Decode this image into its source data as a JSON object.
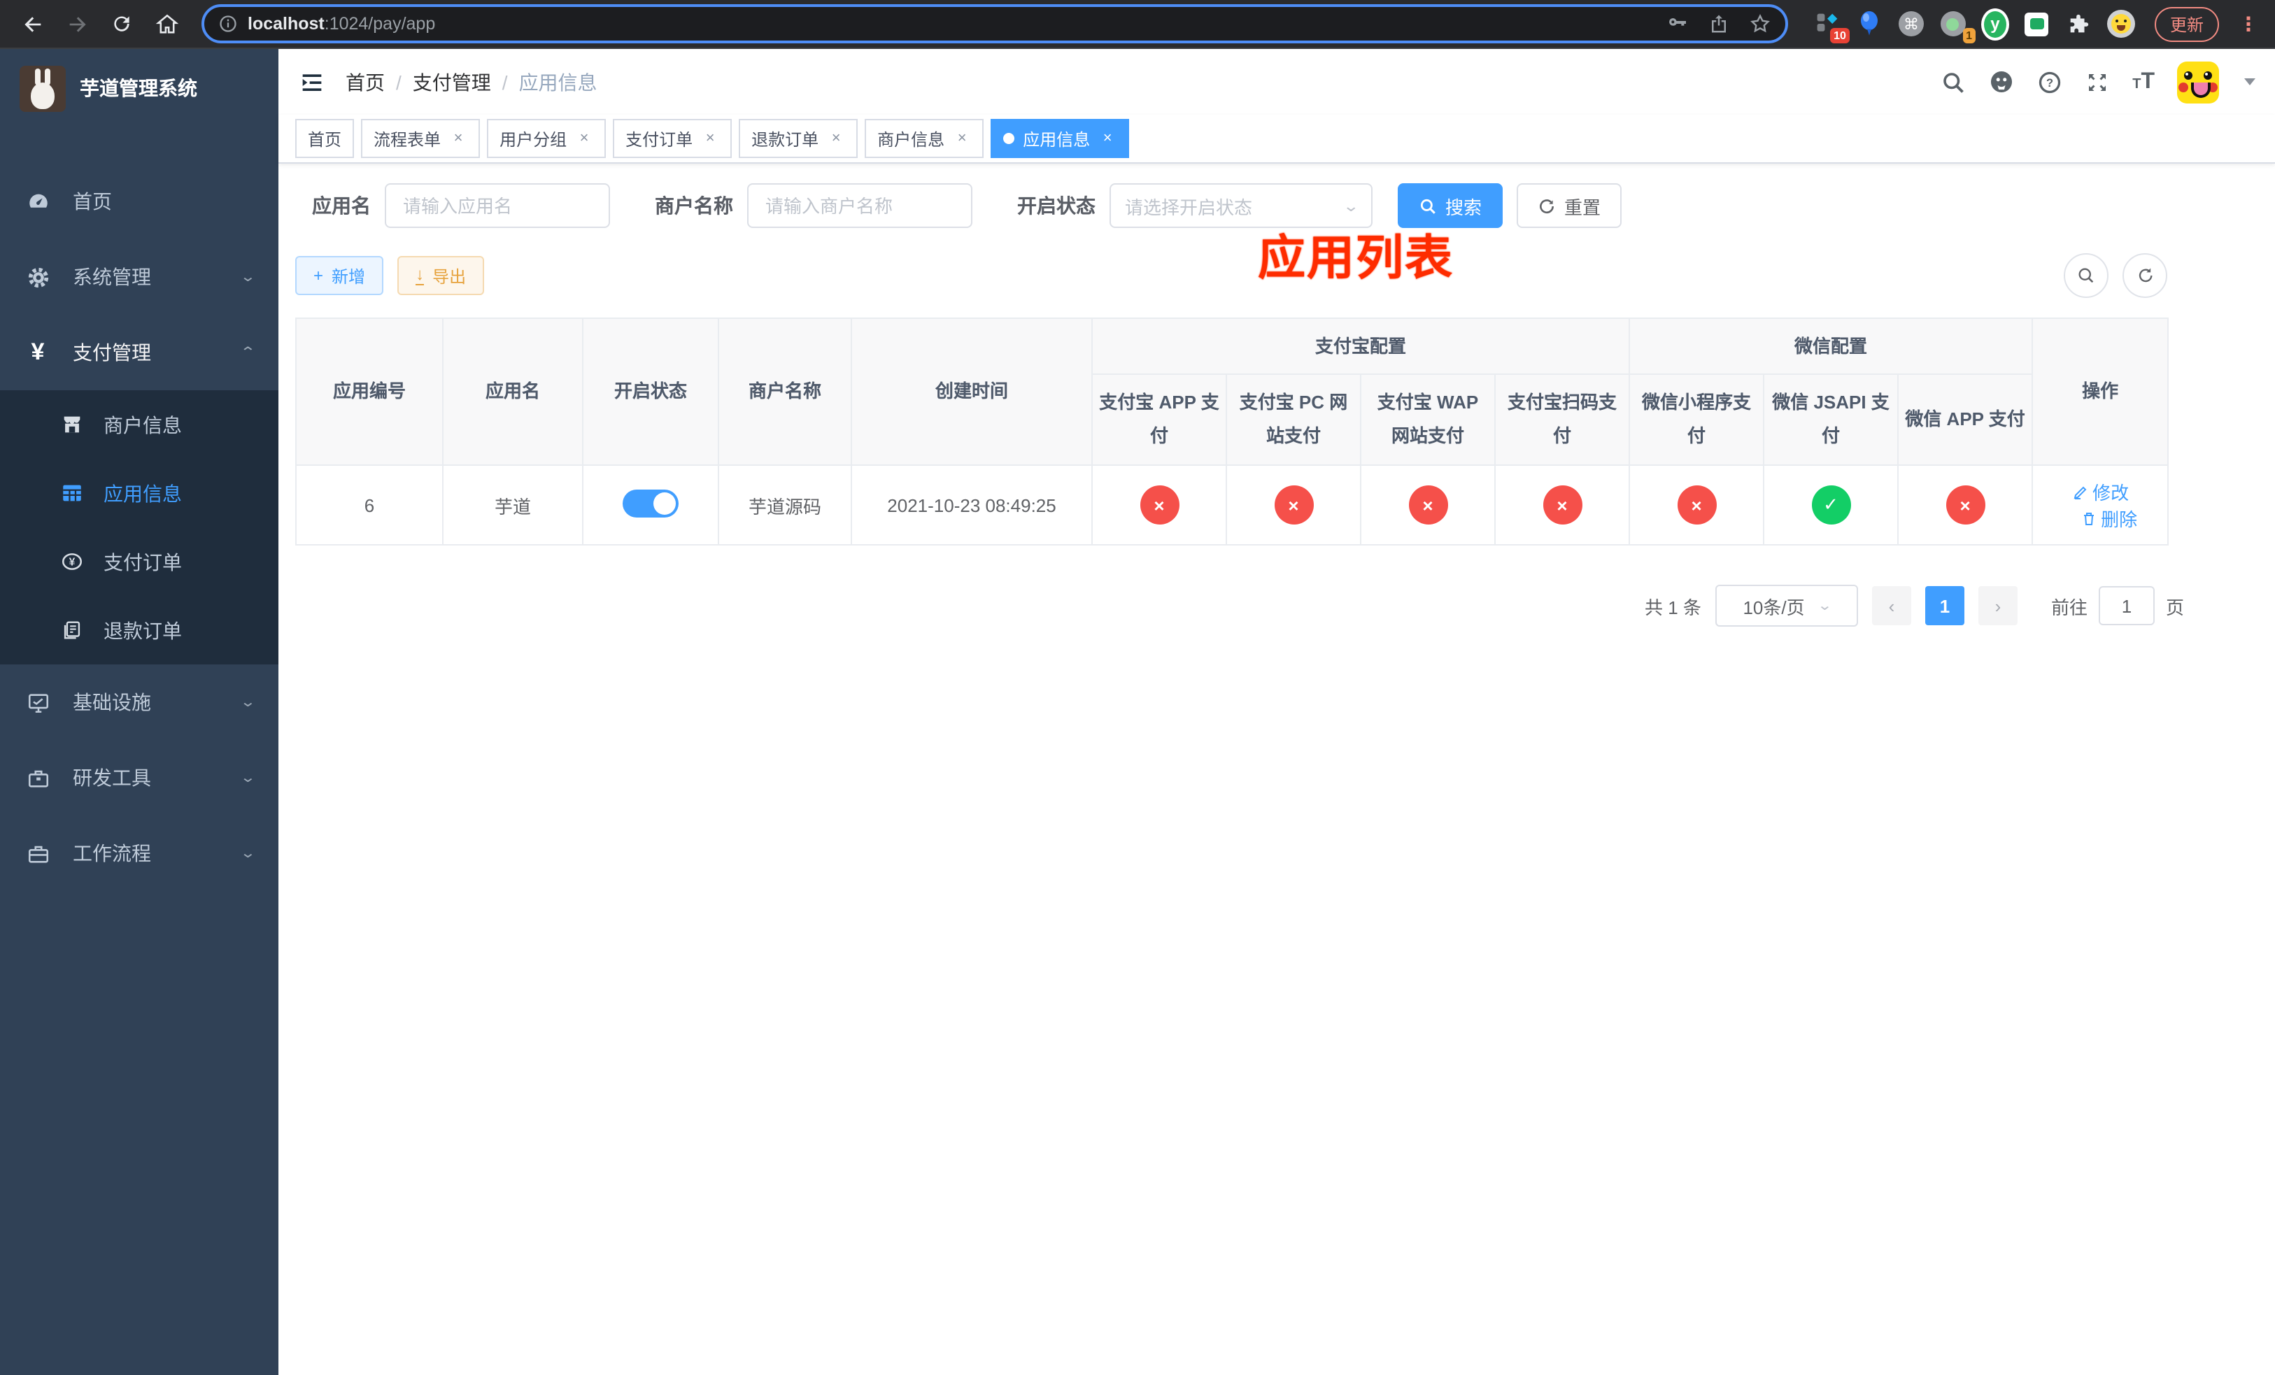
{
  "colors": {
    "accent": "#409eff",
    "danger": "#f5504a",
    "success": "#13ce66",
    "annotation_red": "#fe2c00",
    "sidebar_bg": "#304156",
    "submenu_bg": "#1f2d3d"
  },
  "browser": {
    "url_host": "localhost",
    "url_rest": ":1024/pay/app",
    "update_label": "更新",
    "ext_badge_grid": "10",
    "ext_badge_meet": "1",
    "ext_y": "y",
    "cmd_glyph": "⌘"
  },
  "annotation": "应用列表",
  "sidebar": {
    "title": "芋道管理系统",
    "items": [
      {
        "label": "首页"
      },
      {
        "label": "系统管理"
      },
      {
        "label": "支付管理"
      },
      {
        "label": "基础设施"
      },
      {
        "label": "研发工具"
      },
      {
        "label": "工作流程"
      }
    ],
    "submenu": [
      {
        "label": "商户信息"
      },
      {
        "label": "应用信息"
      },
      {
        "label": "支付订单"
      },
      {
        "label": "退款订单"
      }
    ],
    "chev_down": "⌄",
    "chev_up": "⌃"
  },
  "header": {
    "breadcrumb": [
      "首页",
      "支付管理",
      "应用信息"
    ],
    "separator": "/"
  },
  "tabs": {
    "close_glyph": "×",
    "items": [
      {
        "label": "首页"
      },
      {
        "label": "流程表单"
      },
      {
        "label": "用户分组"
      },
      {
        "label": "支付订单"
      },
      {
        "label": "退款订单"
      },
      {
        "label": "商户信息"
      },
      {
        "label": "应用信息"
      }
    ]
  },
  "filters": {
    "app_name_label": "应用名",
    "app_name_placeholder": "请输入应用名",
    "merchant_label": "商户名称",
    "merchant_placeholder": "请输入商户名称",
    "status_label": "开启状态",
    "status_placeholder": "请选择开启状态",
    "search_label": "搜索",
    "reset_label": "重置"
  },
  "toolbar": {
    "add_label": "新增",
    "export_label": "导出",
    "add_glyph": "+",
    "export_glyph": "↓"
  },
  "table": {
    "headers": {
      "app_id": "应用编号",
      "app_name": "应用名",
      "enabled": "开启状态",
      "merchant": "商户名称",
      "created": "创建时间",
      "alipay_group": "支付宝配置",
      "wechat_group": "微信配置",
      "alipay_app": "支付宝 APP 支付",
      "alipay_pc": "支付宝 PC 网站支付",
      "alipay_wap": "支付宝 WAP 网站支付",
      "alipay_qr": "支付宝扫码支付",
      "wx_lite": "微信小程序支付",
      "wx_jsapi": "微信 JSAPI 支付",
      "wx_app": "微信 APP 支付",
      "actions": "操作"
    },
    "status_glyphs": {
      "ok": "✓",
      "fail": "×"
    },
    "row": {
      "app_id": "6",
      "app_name": "芋道",
      "enabled": true,
      "merchant": "芋道源码",
      "created": "2021-10-23 08:49:25",
      "statuses": [
        false,
        false,
        false,
        false,
        false,
        true,
        false
      ],
      "edit_label": "修改",
      "delete_label": "删除"
    }
  },
  "pagination": {
    "total": "共 1 条",
    "page_size": "10条/页",
    "prev": "‹",
    "next": "›",
    "page": "1",
    "goto_prefix": "前往",
    "goto_value": "1",
    "goto_suffix": "页"
  }
}
